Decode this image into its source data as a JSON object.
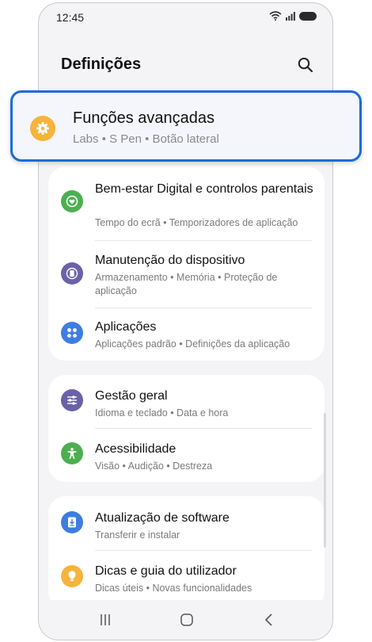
{
  "status_bar": {
    "time": "12:45"
  },
  "header": {
    "title": "Definições"
  },
  "featured": {
    "title": "Funções avançadas",
    "subtitle": "Labs  •  S Pen  •  Botão lateral",
    "icon": "gear-icon",
    "icon_color": "#f6b43c",
    "highlight_color": "#1a6bd8"
  },
  "groups": [
    {
      "items": [
        {
          "title": "Bem-estar Digital e controlos parentais",
          "subtitle": "Tempo do ecrã  •  Temporizadores de aplicação",
          "icon": "wellbeing-icon",
          "icon_color": "#4caf50"
        },
        {
          "title": "Manutenção do dispositivo",
          "subtitle": "Armazenamento  •  Memória  •  Proteção de aplicação",
          "icon": "device-care-icon",
          "icon_color": "#6a61a9"
        },
        {
          "title": "Aplicações",
          "subtitle": "Aplicações padrão  •  Definições da aplicação",
          "icon": "apps-icon",
          "icon_color": "#3f7de0"
        }
      ]
    },
    {
      "items": [
        {
          "title": "Gestão geral",
          "subtitle": "Idioma e teclado  •  Data e hora",
          "icon": "sliders-icon",
          "icon_color": "#6a61a9"
        },
        {
          "title": "Acessibilidade",
          "subtitle": "Visão  •  Audição  •  Destreza",
          "icon": "accessibility-icon",
          "icon_color": "#4caf50"
        }
      ]
    },
    {
      "items": [
        {
          "title": "Atualização de software",
          "subtitle": "Transferir e instalar",
          "icon": "software-update-icon",
          "icon_color": "#3f7de0"
        },
        {
          "title": "Dicas e guia do utilizador",
          "subtitle": "Dicas úteis  •  Novas funcionalidades",
          "icon": "lightbulb-icon",
          "icon_color": "#f6b43c"
        }
      ]
    }
  ]
}
